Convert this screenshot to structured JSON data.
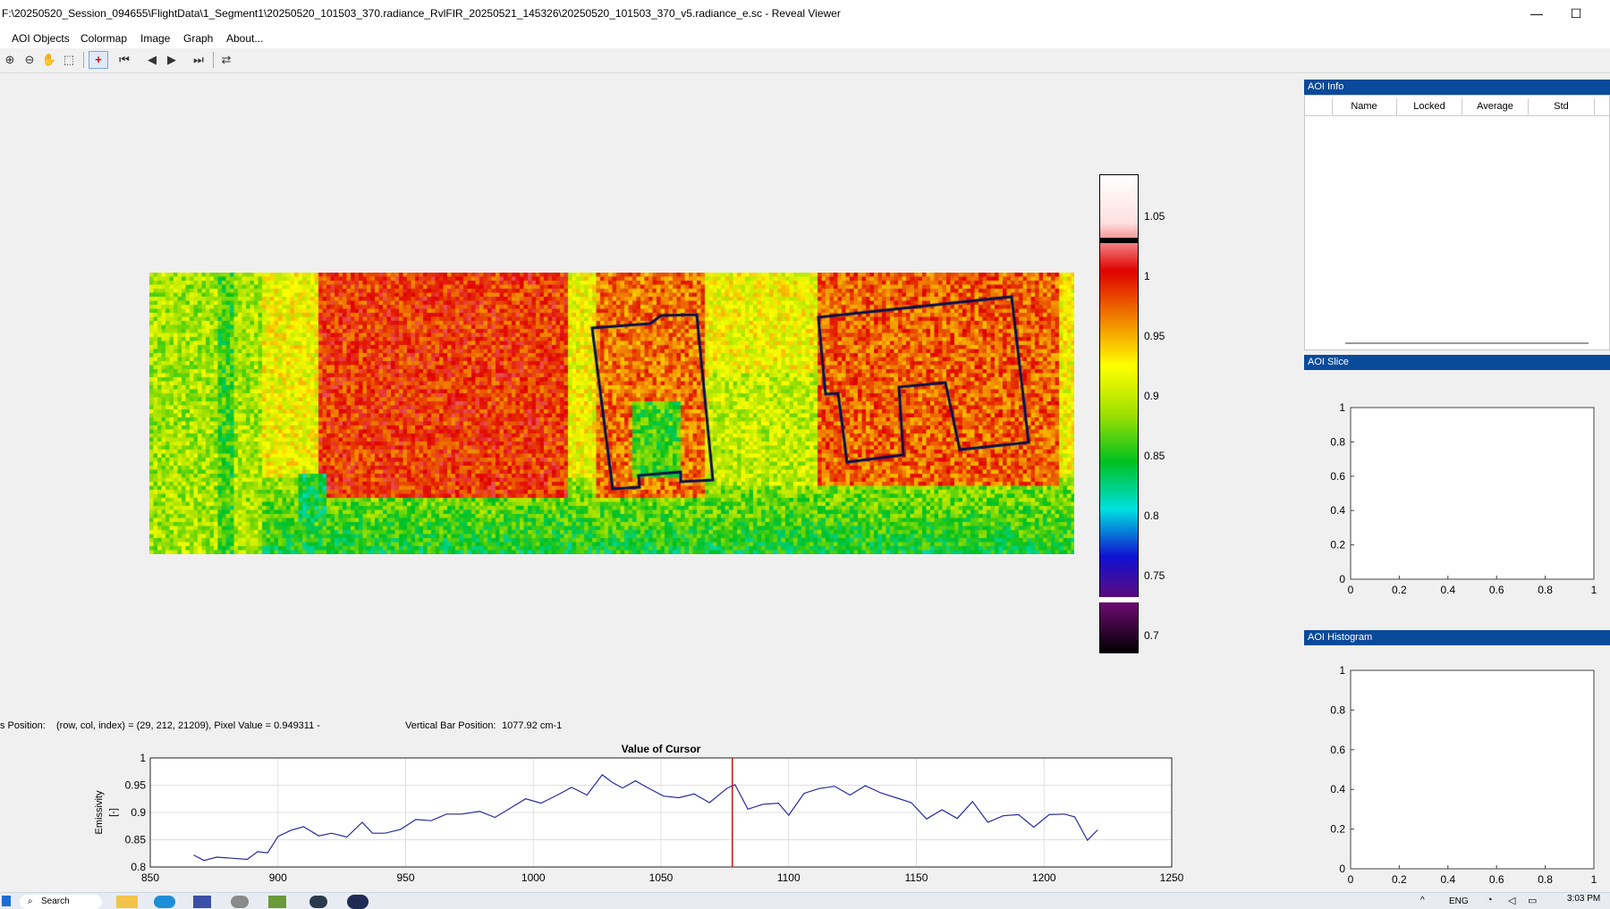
{
  "window": {
    "title": "F:\\20250520_Session_094655\\FlightData\\1_Segment1\\20250520_101503_370.radiance_RvlFIR_20250521_145326\\20250520_101503_370_v5.radiance_e.sc - Reveal Viewer",
    "minimize_glyph": "—",
    "maximize_glyph": "☐"
  },
  "menu": [
    "AOI Objects",
    "Colormap",
    "Image",
    "Graph",
    "About..."
  ],
  "toolbar": {
    "icons": [
      "zoom-in-icon",
      "zoom-out-icon",
      "pan-hand-icon",
      "select-region-icon",
      "crosshair-icon",
      "first-frame-icon",
      "prev-frame-icon",
      "next-frame-icon",
      "last-frame-icon",
      "swap-icon"
    ],
    "glyphs": [
      "⊕",
      "⊖",
      "✋",
      "⬚",
      "+",
      "⏮",
      "◀",
      "▶",
      "⏭",
      "⇄"
    ]
  },
  "colorbar": {
    "ticks": [
      "1.05",
      "1",
      "0.95",
      "0.9",
      "0.85",
      "0.8",
      "0.75",
      "0.7"
    ],
    "tick_values": [
      1.05,
      1.0,
      0.95,
      0.9,
      0.85,
      0.8,
      0.75,
      0.7
    ],
    "range": [
      0.685,
      1.085
    ],
    "stops": [
      "#000000",
      "#6a0a6e",
      "#1010d0",
      "#00e0e0",
      "#00c020",
      "#a0e000",
      "#ffff00",
      "#f08000",
      "#e00000",
      "#ffe0e0",
      "#ffffff"
    ],
    "markers": [
      0.73,
      1.03
    ]
  },
  "status": {
    "cursor_label": "s Position:",
    "cursor_value": "(row, col, index) = (29, 212, 21209), Pixel Value = 0.949311 -",
    "vbar_label": "Vertical Bar Position:",
    "vbar_value": "1077.92 cm-1"
  },
  "panels": {
    "aoi_info": {
      "title": "AOI Info",
      "columns": [
        "Name",
        "Locked",
        "Average",
        "Std"
      ]
    },
    "aoi_slice": {
      "title": "AOI Slice"
    },
    "aoi_histogram": {
      "title": "AOI Histogram"
    }
  },
  "chart_data": [
    {
      "type": "line",
      "title": "Value of Cursor",
      "xlabel": "",
      "ylabel": "Emissivity",
      "ylabel2": "[-]",
      "xlim": [
        850,
        1250
      ],
      "ylim": [
        0.8,
        1
      ],
      "xticks": [
        850,
        900,
        950,
        1000,
        1050,
        1100,
        1150,
        1200,
        1250
      ],
      "yticks": [
        0.8,
        0.85,
        0.9,
        0.95,
        1
      ],
      "ytick_labels": [
        "0.8",
        "0.85",
        "0.9",
        "0.95",
        "1"
      ],
      "grid": true,
      "cursor_line_x": 1077.92,
      "series": [
        {
          "color": "#2a2aa0",
          "x": [
            867,
            871,
            876,
            882,
            888,
            892,
            896,
            900,
            905,
            910,
            916,
            921,
            927,
            933,
            937,
            942,
            948,
            954,
            960,
            966,
            972,
            979,
            985,
            991,
            997,
            1003,
            1009,
            1015,
            1021,
            1027,
            1031,
            1035,
            1040,
            1045,
            1051,
            1057,
            1063,
            1069,
            1076,
            1079,
            1084,
            1090,
            1096,
            1100,
            1106,
            1112,
            1118,
            1124,
            1130,
            1136,
            1142,
            1148,
            1154,
            1160,
            1166,
            1172,
            1178,
            1184,
            1190,
            1196,
            1202,
            1208,
            1212,
            1217,
            1221
          ],
          "values": [
            0.822,
            0.812,
            0.818,
            0.816,
            0.814,
            0.828,
            0.826,
            0.856,
            0.867,
            0.874,
            0.857,
            0.862,
            0.855,
            0.882,
            0.862,
            0.862,
            0.869,
            0.887,
            0.885,
            0.897,
            0.897,
            0.902,
            0.891,
            0.908,
            0.925,
            0.917,
            0.931,
            0.946,
            0.932,
            0.969,
            0.955,
            0.945,
            0.958,
            0.945,
            0.93,
            0.927,
            0.934,
            0.918,
            0.945,
            0.951,
            0.906,
            0.915,
            0.917,
            0.895,
            0.935,
            0.944,
            0.948,
            0.932,
            0.949,
            0.936,
            0.927,
            0.918,
            0.888,
            0.905,
            0.889,
            0.92,
            0.882,
            0.894,
            0.896,
            0.873,
            0.896,
            0.897,
            0.892,
            0.849,
            0.868
          ]
        }
      ]
    },
    {
      "type": "line",
      "title": "",
      "xlim": [
        0,
        1
      ],
      "ylim": [
        0,
        1
      ],
      "xticks": [
        0,
        0.2,
        0.4,
        0.6,
        0.8,
        1
      ],
      "yticks": [
        0,
        0.2,
        0.4,
        0.6,
        0.8,
        1
      ],
      "xtick_labels": [
        "0",
        "0.2",
        "0.4",
        "0.6",
        "0.8",
        "1"
      ],
      "ytick_labels": [
        "0",
        "0.2",
        "0.4",
        "0.6",
        "0.8",
        "1"
      ],
      "series": []
    },
    {
      "type": "line",
      "title": "",
      "xlim": [
        0,
        1
      ],
      "ylim": [
        0,
        1
      ],
      "xticks": [
        0,
        0.2,
        0.4,
        0.6,
        0.8,
        1
      ],
      "yticks": [
        0,
        0.2,
        0.4,
        0.6,
        0.8,
        1
      ],
      "xtick_labels": [
        "0",
        "0.2",
        "0.4",
        "0.6",
        "0.8",
        "1"
      ],
      "ytick_labels": [
        "0",
        "0.2",
        "0.4",
        "0.6",
        "0.8",
        "1"
      ],
      "series": []
    }
  ],
  "taskbar": {
    "search_label": "Search",
    "lang": "ENG",
    "time": "3:03 PM"
  }
}
